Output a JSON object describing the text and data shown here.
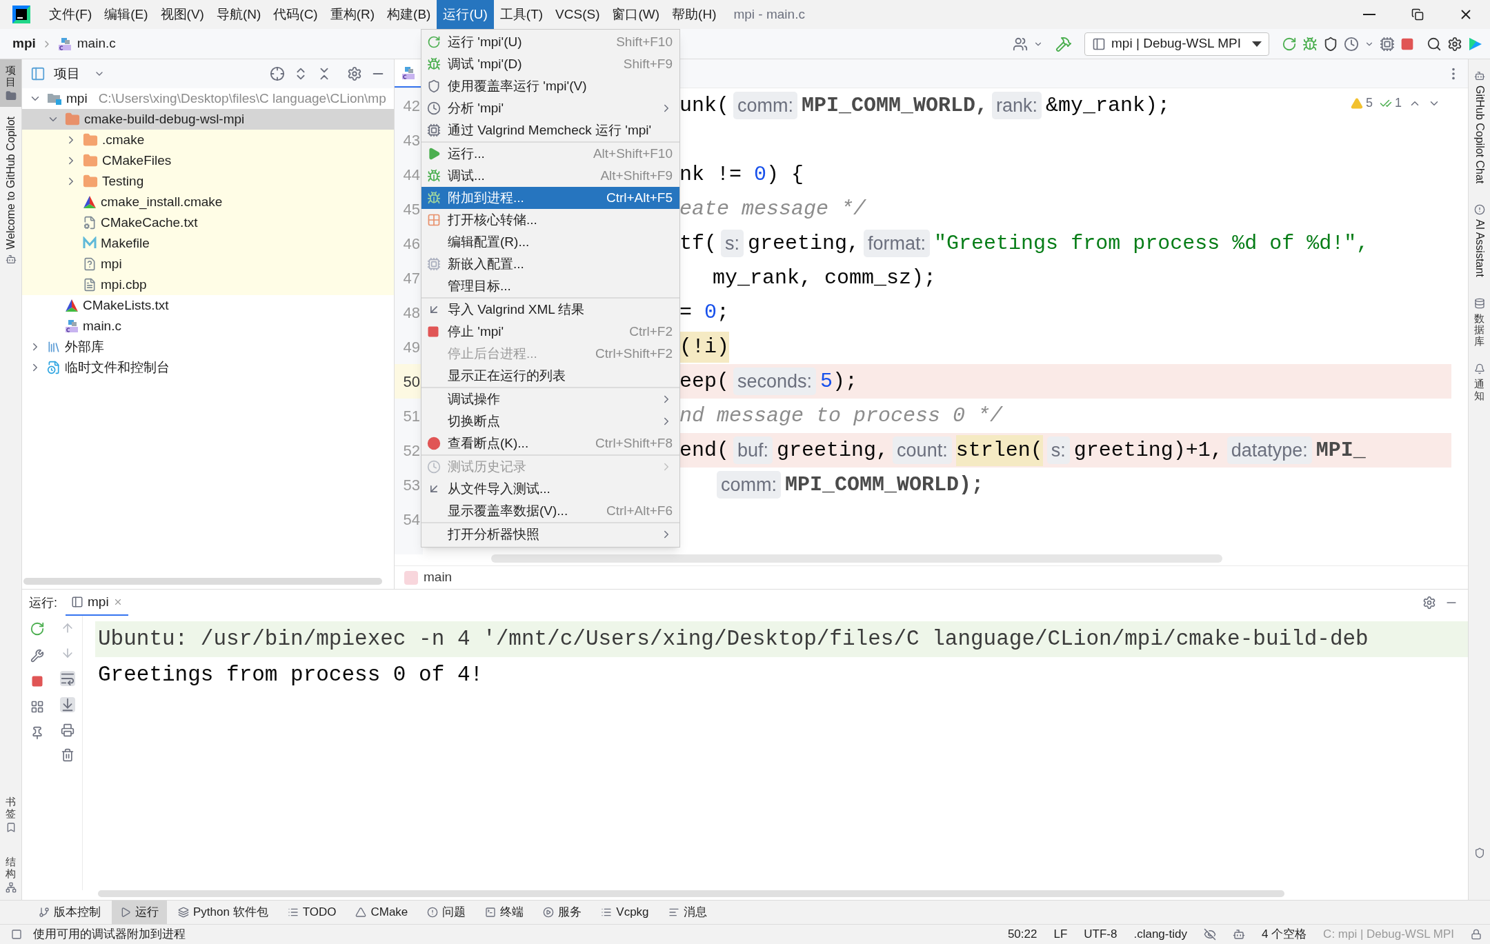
{
  "title_bar": {
    "menus": [
      {
        "label": "文件(F)",
        "selected": false
      },
      {
        "label": "编辑(E)",
        "selected": false
      },
      {
        "label": "视图(V)",
        "selected": false
      },
      {
        "label": "导航(N)",
        "selected": false
      },
      {
        "label": "代码(C)",
        "selected": false
      },
      {
        "label": "重构(R)",
        "selected": false
      },
      {
        "label": "构建(B)",
        "selected": false
      },
      {
        "label": "运行(U)",
        "selected": true
      },
      {
        "label": "工具(T)",
        "selected": false
      },
      {
        "label": "VCS(S)",
        "selected": false
      },
      {
        "label": "窗口(W)",
        "selected": false
      },
      {
        "label": "帮助(H)",
        "selected": false
      }
    ],
    "title": "mpi - main.c"
  },
  "nav_bar": {
    "crumbs": [
      "mpi",
      "main.c"
    ],
    "run_config": "mpi | Debug-WSL MPI"
  },
  "left_strip": {
    "project": {
      "label": "项目",
      "selected": true
    },
    "copilot": "Welcome to GitHub Copilot",
    "bottom": [
      "书签",
      "结构"
    ]
  },
  "right_strip": {
    "copilot_chat": "GitHub Copilot Chat",
    "ai": "AI Assistant",
    "database": "数据库",
    "notifications": "通知"
  },
  "project": {
    "title": "项目",
    "tree": [
      {
        "label": "mpi",
        "kind": "module",
        "path": "C:\\Users\\xing\\Desktop\\files\\C language\\CLion\\mp",
        "expanded": true,
        "selected": false,
        "children": [
          {
            "label": "cmake-build-debug-wsl-mpi",
            "kind": "build",
            "expanded": true,
            "selected": true,
            "excluded": true,
            "children": [
              {
                "label": ".cmake",
                "kind": "folder",
                "expanded": false,
                "selected": false
              },
              {
                "label": "CMakeFiles",
                "kind": "folder",
                "expanded": false,
                "selected": false
              },
              {
                "label": "Testing",
                "kind": "folder",
                "expanded": false,
                "selected": false
              },
              {
                "label": "cmake_install.cmake",
                "kind": "cmake",
                "selected": false
              },
              {
                "label": "CMakeCache.txt",
                "kind": "cache",
                "selected": false
              },
              {
                "label": "Makefile",
                "kind": "makefile",
                "selected": false
              },
              {
                "label": "mpi",
                "kind": "exec",
                "selected": false
              },
              {
                "label": "mpi.cbp",
                "kind": "text",
                "selected": false
              }
            ]
          },
          {
            "label": "CMakeLists.txt",
            "kind": "cmakelists",
            "selected": false
          },
          {
            "label": "main.c",
            "kind": "cfile",
            "selected": false
          }
        ]
      },
      {
        "label": "外部库",
        "kind": "library",
        "expanded": false,
        "selected": false
      },
      {
        "label": "临时文件和控制台",
        "kind": "scratch",
        "expanded": false,
        "selected": false
      }
    ]
  },
  "editor": {
    "problems": {
      "warnings": "5",
      "weak": "1"
    },
    "breadcrumb": "main",
    "lines": [
      {
        "number": "42",
        "highlighted": false,
        "current": false,
        "indented": false,
        "tokens": [
          {
            "text": "unk(",
            "kind": "plain"
          },
          {
            "text": "comm:",
            "kind": "hint"
          },
          {
            "text": "MPI_COMM_WORLD,",
            "kind": "macro"
          },
          {
            "text": "rank:",
            "kind": "hint"
          },
          {
            "text": "&my_rank);",
            "kind": "plain"
          }
        ]
      },
      {
        "number": "43",
        "highlighted": false,
        "current": false
      },
      {
        "number": "44",
        "highlighted": false,
        "current": false,
        "indented": false,
        "tokens": [
          {
            "text": "nk != ",
            "kind": "plain"
          },
          {
            "text": "0",
            "kind": "number"
          },
          {
            "text": ") {",
            "kind": "plain"
          }
        ]
      },
      {
        "number": "45",
        "highlighted": false,
        "current": false,
        "indented": false,
        "tokens": [
          {
            "text": "eate message */",
            "kind": "comment"
          }
        ]
      },
      {
        "number": "46",
        "highlighted": false,
        "current": false,
        "indented": false,
        "tokens": [
          {
            "text": "tf(",
            "kind": "plain"
          },
          {
            "text": "s:",
            "kind": "hint"
          },
          {
            "text": "greeting,",
            "kind": "plain"
          },
          {
            "text": "format:",
            "kind": "hint"
          },
          {
            "text": "\"Greetings from process %d of %d!\",",
            "kind": "string"
          }
        ]
      },
      {
        "number": "47",
        "highlighted": false,
        "current": false,
        "indented": true,
        "tokens": [
          {
            "text": "my_rank, comm_sz);",
            "kind": "plain"
          }
        ]
      },
      {
        "number": "48",
        "highlighted": false,
        "current": false,
        "indented": false,
        "tokens": [
          {
            "text": "= ",
            "kind": "plain"
          },
          {
            "text": "0",
            "kind": "number"
          },
          {
            "text": ";",
            "kind": "plain"
          }
        ]
      },
      {
        "number": "49",
        "highlighted": false,
        "current": false,
        "indented": false,
        "tokens": [
          {
            "text": "(!i)",
            "kind": "match"
          }
        ]
      },
      {
        "number": "50",
        "highlighted": true,
        "current": true,
        "indented": false,
        "tokens": [
          {
            "text": "eep(",
            "kind": "plain"
          },
          {
            "text": "seconds:",
            "kind": "hint"
          },
          {
            "text": "5",
            "kind": "number"
          },
          {
            "text": ");",
            "kind": "plain"
          }
        ]
      },
      {
        "number": "51",
        "highlighted": false,
        "current": false,
        "indented": false,
        "tokens": [
          {
            "text": "nd message to process 0 */",
            "kind": "comment"
          }
        ]
      },
      {
        "number": "52",
        "highlighted": true,
        "current": false,
        "indented": false,
        "tokens": [
          {
            "text": "end(",
            "kind": "plain"
          },
          {
            "text": "buf:",
            "kind": "hint"
          },
          {
            "text": "greeting,",
            "kind": "plain"
          },
          {
            "text": "count:",
            "kind": "hint"
          },
          {
            "text": "strlen(",
            "kind": "match"
          },
          {
            "text": "s:",
            "kind": "hint"
          },
          {
            "text": "greeting)+1,",
            "kind": "plain"
          },
          {
            "text": "datatype:",
            "kind": "hint"
          },
          {
            "text": "MPI_",
            "kind": "macro"
          }
        ]
      },
      {
        "number": "53",
        "highlighted": false,
        "current": false,
        "indented": true,
        "tokens": [
          {
            "text": "comm:",
            "kind": "hint"
          },
          {
            "text": "MPI_COMM_WORLD);",
            "kind": "macro"
          }
        ]
      },
      {
        "number": "54",
        "highlighted": false,
        "current": false
      }
    ]
  },
  "run_menu": {
    "groups": [
      [
        {
          "label": "运行 'mpi'(U)",
          "shortcut": "Shift+F10",
          "submenu": false,
          "disabled": false,
          "selected": false
        },
        {
          "label": "调试 'mpi'(D)",
          "shortcut": "Shift+F9",
          "submenu": false,
          "disabled": false,
          "selected": false
        },
        {
          "label": "使用覆盖率运行 'mpi'(V)",
          "submenu": false,
          "disabled": false,
          "selected": false
        },
        {
          "label": "分析 'mpi'",
          "submenu": true,
          "disabled": false,
          "selected": false
        },
        {
          "label": "通过 Valgrind Memcheck 运行 'mpi'",
          "submenu": false,
          "disabled": false,
          "selected": false
        }
      ],
      [
        {
          "label": "运行...",
          "shortcut": "Alt+Shift+F10",
          "submenu": false,
          "disabled": false,
          "selected": false
        },
        {
          "label": "调试...",
          "shortcut": "Alt+Shift+F9",
          "submenu": false,
          "disabled": false,
          "selected": false
        },
        {
          "label": "附加到进程...",
          "shortcut": "Ctrl+Alt+F5",
          "submenu": false,
          "disabled": false,
          "selected": true
        },
        {
          "label": "打开核心转储...",
          "submenu": false,
          "disabled": false,
          "selected": false
        },
        {
          "label": "编辑配置(R)...",
          "submenu": false,
          "disabled": false,
          "selected": false
        },
        {
          "label": "新嵌入配置...",
          "submenu": false,
          "disabled": false,
          "selected": false
        },
        {
          "label": "管理目标...",
          "submenu": false,
          "disabled": false,
          "selected": false
        }
      ],
      [
        {
          "label": "导入 Valgrind XML 结果",
          "submenu": false,
          "disabled": false,
          "selected": false
        },
        {
          "label": "停止 'mpi'",
          "shortcut": "Ctrl+F2",
          "submenu": false,
          "disabled": false,
          "selected": false
        },
        {
          "label": "停止后台进程...",
          "shortcut": "Ctrl+Shift+F2",
          "submenu": false,
          "disabled": true,
          "selected": false
        },
        {
          "label": "显示正在运行的列表",
          "submenu": false,
          "disabled": false,
          "selected": false
        }
      ],
      [
        {
          "label": "调试操作",
          "submenu": true,
          "disabled": false,
          "selected": false
        },
        {
          "label": "切换断点",
          "submenu": true,
          "disabled": false,
          "selected": false
        },
        {
          "label": "查看断点(K)...",
          "shortcut": "Ctrl+Shift+F8",
          "submenu": false,
          "disabled": false,
          "selected": false
        }
      ],
      [
        {
          "label": "测试历史记录",
          "submenu": true,
          "disabled": true,
          "selected": false
        },
        {
          "label": "从文件导入测试...",
          "submenu": false,
          "disabled": false,
          "selected": false
        },
        {
          "label": "显示覆盖率数据(V)...",
          "shortcut": "Ctrl+Alt+F6",
          "submenu": false,
          "disabled": false,
          "selected": false
        }
      ],
      [
        {
          "label": "打开分析器快照",
          "submenu": true,
          "disabled": false,
          "selected": false
        }
      ]
    ]
  },
  "run_panel": {
    "label": "运行:",
    "tab": "mpi",
    "console": [
      {
        "text": "Ubuntu: /usr/bin/mpiexec -n 4 '/mnt/c/Users/xing/Desktop/files/C language/CLion/mpi/cmake-build-deb",
        "kind": "command"
      },
      {
        "text": "Greetings from process 0 of 4!",
        "kind": "output"
      }
    ]
  },
  "tool_tabs": [
    {
      "label": "版本控制",
      "selected": false
    },
    {
      "label": "运行",
      "selected": true
    },
    {
      "label": "Python 软件包",
      "selected": false
    },
    {
      "label": "TODO",
      "selected": false
    },
    {
      "label": "CMake",
      "selected": false
    },
    {
      "label": "问题",
      "selected": false
    },
    {
      "label": "终端",
      "selected": false
    },
    {
      "label": "服务",
      "selected": false
    },
    {
      "label": "Vcpkg",
      "selected": false
    },
    {
      "label": "消息",
      "selected": false
    }
  ],
  "status_bar": {
    "message": "使用可用的调试器附加到进程",
    "position": "50:22",
    "line_sep": "LF",
    "encoding": "UTF-8",
    "linter": ".clang-tidy",
    "indent": "4 个空格",
    "context": "C: mpi | Debug-WSL MPI"
  }
}
